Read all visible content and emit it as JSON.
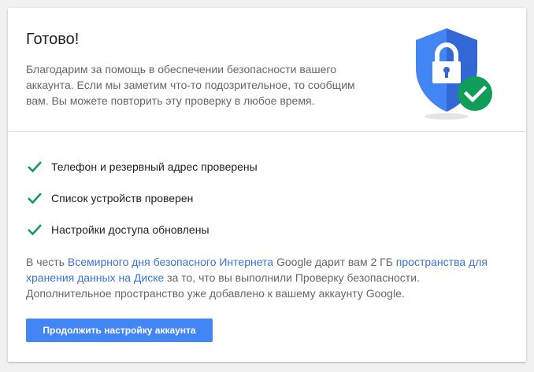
{
  "card": {
    "title": "Готово!",
    "description": "Благодарим за помощь в обеспечении безопасности вашего аккаунта. Если мы заметим что-то подозрительное, то сообщим вам. Вы можете повторить эту проверку в любое время.",
    "illustration_icon": "shield-lock-check-icon"
  },
  "checks": [
    {
      "icon": "check-icon",
      "label": "Телефон и резервный адрес проверены"
    },
    {
      "icon": "check-icon",
      "label": "Список устройств проверен"
    },
    {
      "icon": "check-icon",
      "label": "Настройки доступа обновлены"
    }
  ],
  "promo": {
    "part1": "В честь ",
    "link1": "Всемирного дня безопасного Интернета",
    "part2": " Google дарит вам 2 ГБ ",
    "link2": "пространства для хранения данных на Диске",
    "part3": " за то, что вы выполнили Проверку безопасности. Дополнительное пространство уже добавлено к вашему аккаунту Google."
  },
  "actions": {
    "continue_label": "Продолжить настройку аккаунта"
  },
  "colors": {
    "accent": "#4285f4",
    "link": "#3b73d6",
    "check_green": "#0f9d58",
    "shield_blue": "#4285f4",
    "shield_dark": "#3367d6",
    "badge_green": "#0f9d58"
  }
}
